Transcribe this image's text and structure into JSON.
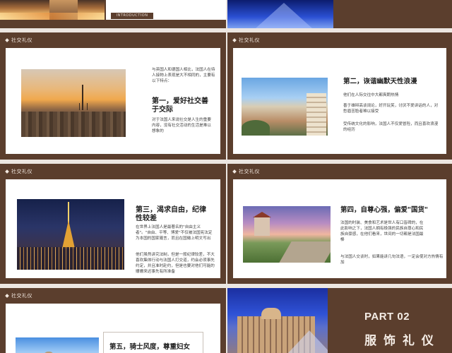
{
  "colors": {
    "brown": "#5b3e2d",
    "cream": "#f2e8e0",
    "page_bg": "#ece6e1"
  },
  "top": {
    "intro_label": "INTRODUCTION"
  },
  "slides": {
    "s3": {
      "tag": "社交礼仪",
      "intro": "与英国人和德国人相比，法国人在待人接物上表现是大不相同的，主要有以下特点：",
      "title": "第一，爱好社交善于交际",
      "body": "对于法国人来说社交是人生的重要内容，没有社交活动的生活是难以想象的"
    },
    "s4": {
      "tag": "社交礼仪",
      "title": "第二，诙谐幽默天性浪漫",
      "p1": "他们在人际交往中大都爽朗热情",
      "p2": "善于雄辩高谈阔论，好开玩笑，讨厌不爱讲话的人，对愁眉苦脸者难以接受",
      "p3": "受传统文化的影响，法国人不仅爱冒险，而且喜欢浪漫的经历"
    },
    "s5": {
      "tag": "社交礼仪",
      "title": "第三，渴求自由，纪律性较差",
      "p1": "在世界上法国人是最著名的\"自由主义者\"。\"自由、平等、博爱\"不仅被法国宪法定为本国的国家箴言，而且在国徽上明文写出",
      "p2": "他们虽然讲究法制，但是一般纪律较差，不大喜欢集体行动与法国人打交道，约会必须事先约定，并且准时赴约，但是也要对他们可能的姗姗来迟事先有所准备"
    },
    "s6": {
      "tag": "社交礼仪",
      "title": "第四，自尊心强，偏爱\"国货\"",
      "p1": "法国的时装、美食和艺术是世人有口皆碑的，在此影响之下，法国人拥有极强的民族自尊心和民族自豪感，在他们看来，世间的一切都是法国最棒",
      "p2": "与法国人交谈时，如果能讲几句法语，一定会使对方热情有加"
    },
    "s7": {
      "tag": "社交礼仪",
      "title": "第五，骑士风度，尊重妇女"
    },
    "s8": {
      "part": "PART 02",
      "title": "服 饰 礼 仪"
    }
  }
}
